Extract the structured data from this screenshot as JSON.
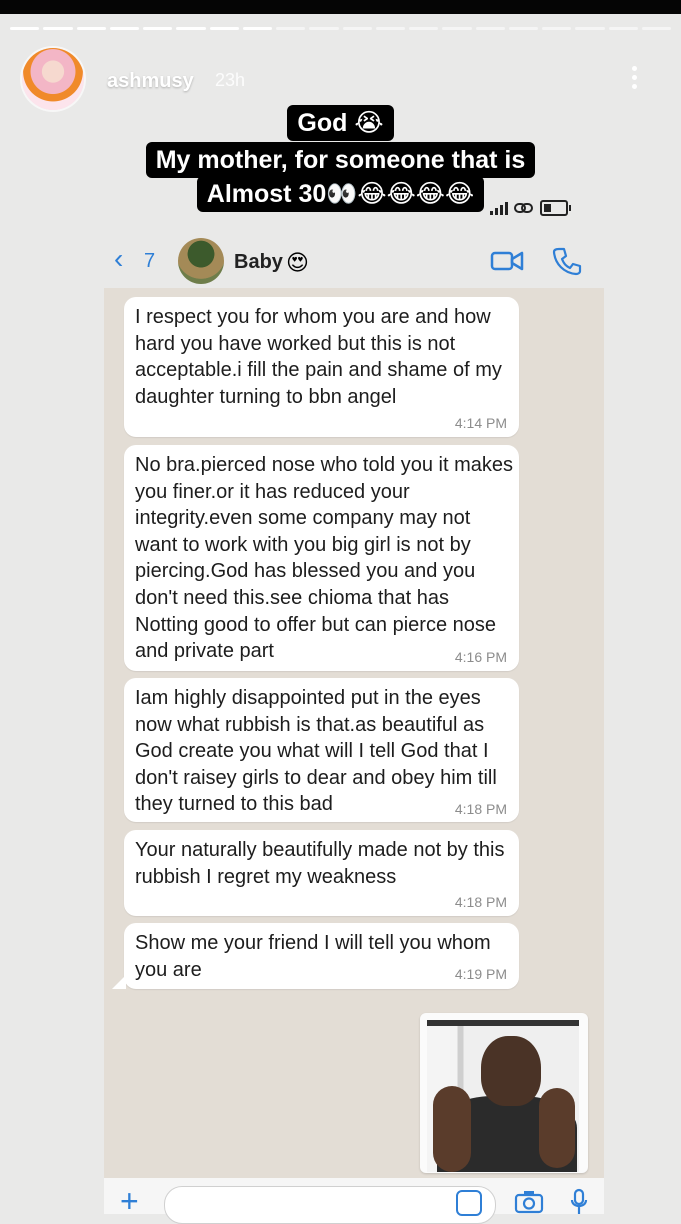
{
  "story": {
    "username": "ashmusy",
    "time": "23h",
    "caption_lines": [
      "God 😭",
      "My mother, for someone that is",
      "Almost 30👀😂😂😂😂"
    ]
  },
  "chat": {
    "back_count": "7",
    "contact_name": "Baby",
    "contact_emoji": "😍",
    "messages": [
      {
        "text": "I respect you for whom you are and how hard you have worked but this is not acceptable.i fill the pain and shame of my daughter turning to bbn angel",
        "time": "4:14 PM"
      },
      {
        "text": "No bra.pierced nose who told you it makes you finer.or it has reduced your integrity.even some company may not want to work with you big girl is not by piercing.God has blessed you and you don't need this.see chioma that has Notting good to offer but can pierce nose and private part",
        "time": "4:16 PM"
      },
      {
        "text": "Iam highly disappointed put in the eyes now what rubbish is that.as beautiful as God create you what will I tell God that I don't raisey girls to dear and obey him till they turned to this bad",
        "time": "4:18 PM"
      },
      {
        "text": "Your naturally beautifully made not by this rubbish I regret my weakness",
        "time": "4:18 PM"
      },
      {
        "text": "Show me your friend I will tell you whom you are",
        "time": "4:19 PM"
      }
    ]
  },
  "icons": {
    "kebab": "more-vert-icon",
    "back": "chevron-left-icon",
    "video": "video-camera-icon",
    "phone": "phone-icon",
    "plus": "plus-icon",
    "sticker": "sticker-icon",
    "camera": "camera-icon",
    "mic": "microphone-icon"
  },
  "colors": {
    "accent": "#2f7fd6",
    "chat_bg": "#e3ddd5",
    "bubble": "#ffffff"
  }
}
